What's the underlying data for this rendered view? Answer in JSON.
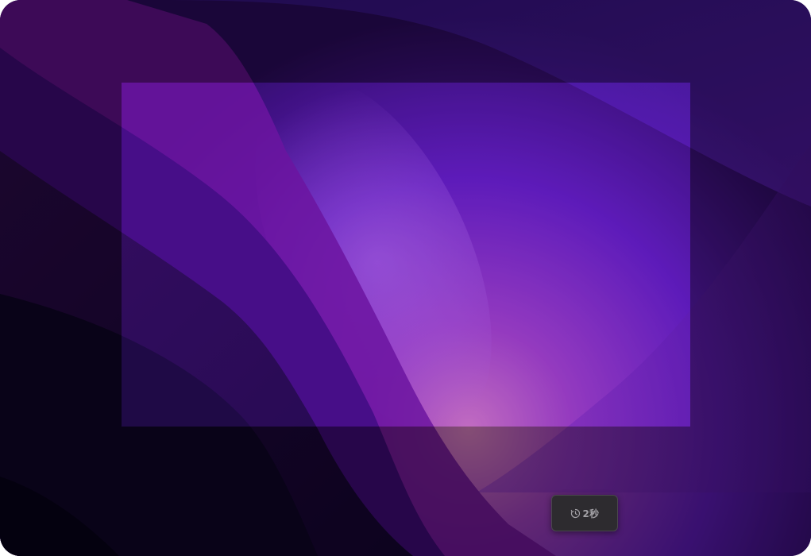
{
  "capture": {
    "timer_label": "2秒",
    "timer_icon": "timer-icon"
  },
  "colors": {
    "wallpaper_base": "#1c0838",
    "wallpaper_glow": "#c060b0",
    "selection_accent": "#6a2ae8",
    "timer_button_bg": "#2d2b2f",
    "timer_text": "#a3a1a6"
  }
}
